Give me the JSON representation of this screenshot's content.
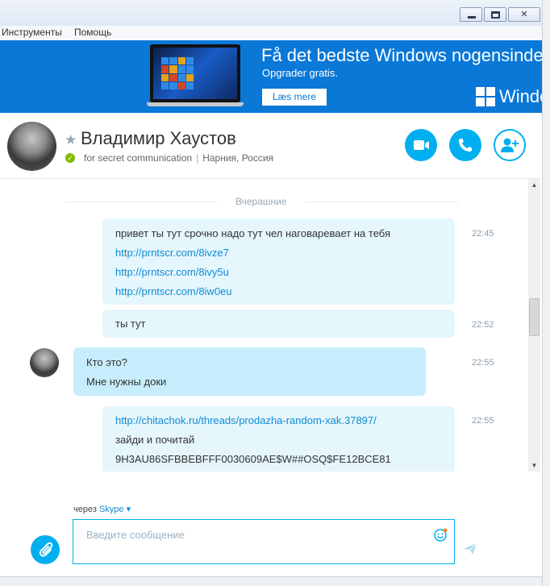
{
  "window": {
    "close_label": "✕"
  },
  "menu": {
    "items": [
      {
        "label": "Инструменты"
      },
      {
        "label": "Помощь"
      }
    ]
  },
  "ad": {
    "title": "Få det bedste Windows nogensinde.",
    "subtitle": "Opgrader gratis.",
    "button_label": "Læs mere",
    "brand_text": "Windo"
  },
  "contact": {
    "name": "Владимир Хаустов",
    "mood": "for secret communication",
    "location": "Нарния, Россия"
  },
  "conversation": {
    "day_divider": "Вчерашние",
    "messages": [
      {
        "direction": "out",
        "time": "22:45",
        "lines": [
          "привет ты тут срочно надо тут чел наговаревает на тебя",
          "http://prntscr.com/8ivze7",
          "http://prntscr.com/8ivy5u",
          "http://prntscr.com/8iw0eu"
        ]
      },
      {
        "direction": "out",
        "time": "22:52",
        "lines": [
          "ты тут"
        ]
      },
      {
        "direction": "in",
        "time": "22:55",
        "lines": [
          "Кто это?",
          "Мне нужны доки"
        ]
      },
      {
        "direction": "out",
        "time": "22:55",
        "lines": [
          "http://chitachok.ru/threads/prodazha-random-xak.37897/",
          "зайди и почитай",
          "9H3AU86SFBBEBFFF0030609AE$W##OSQ$FE12BCE81"
        ]
      }
    ]
  },
  "compose": {
    "via_prefix": "через",
    "via_service": "Skype",
    "via_caret": "▾",
    "placeholder": "Введите сообщение",
    "value": ""
  },
  "scrollbar": {
    "up_arrow": "▲",
    "down_arrow": "▼"
  },
  "colors": {
    "accent": "#00aff0",
    "ad_background": "#0a78d7",
    "bubble_out": "#e5f6fd",
    "bubble_in": "#c7edfc",
    "link": "#0f8bd1",
    "online": "#7fba00"
  },
  "icons": {
    "favorite": "star-icon",
    "status": "online-status-icon",
    "video_call": "video-camera-icon",
    "voice_call": "phone-icon",
    "add_people": "add-person-icon",
    "attach": "paperclip-icon",
    "emoticon": "smiley-icon",
    "send": "send-arrow-icon"
  }
}
